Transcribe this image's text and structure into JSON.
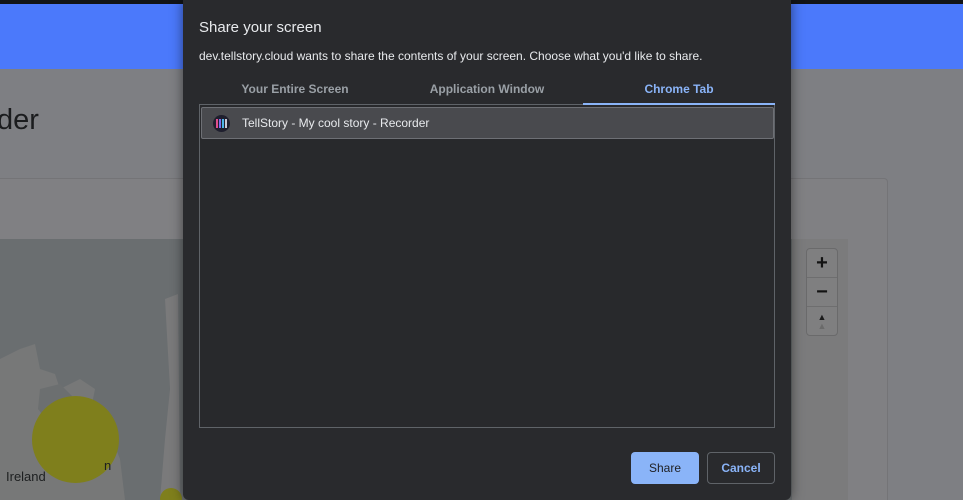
{
  "background": {
    "page_title": "der",
    "map_labels": {
      "ireland": "Ireland",
      "partial": "n"
    },
    "zoom_controls": {
      "zoom_in": "+",
      "zoom_out": "−",
      "compass": "▲"
    }
  },
  "dialog": {
    "title": "Share your screen",
    "description": "dev.tellstory.cloud wants to share the contents of your screen. Choose what you'd like to share.",
    "tabs": [
      {
        "label": "Your Entire Screen",
        "active": false
      },
      {
        "label": "Application Window",
        "active": false
      },
      {
        "label": "Chrome Tab",
        "active": true
      }
    ],
    "items": [
      {
        "label": "TellStory - My cool story - Recorder",
        "icon": "tellstory-favicon",
        "selected": true
      }
    ],
    "buttons": {
      "share": "Share",
      "cancel": "Cancel"
    }
  },
  "colors": {
    "accent": "#8ab4f8",
    "dialog_bg": "#292a2d",
    "header_blue": "#4b79fb"
  }
}
